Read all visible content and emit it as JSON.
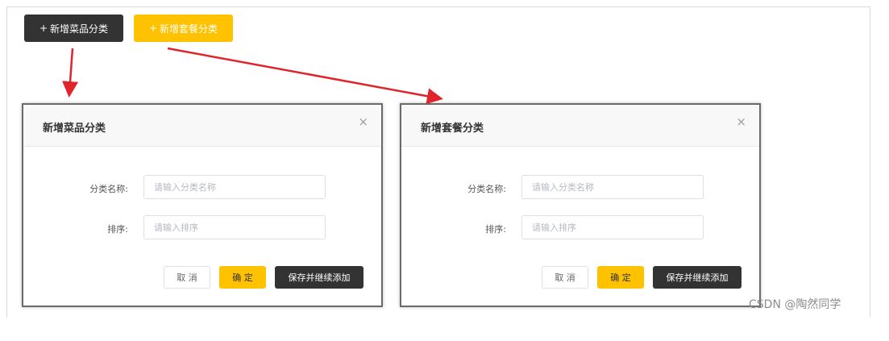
{
  "toolbar": {
    "add_dish_category": {
      "plus": "+",
      "label": "新增菜品分类"
    },
    "add_setmeal_category": {
      "plus": "+",
      "label": "新增套餐分类"
    }
  },
  "dialogs": [
    {
      "title": "新增菜品分类",
      "close": "×",
      "name_label": "分类名称:",
      "name_placeholder": "请输入分类名称",
      "sort_label": "排序:",
      "sort_placeholder": "请输入排序",
      "cancel": "取 消",
      "confirm": "确 定",
      "save_continue": "保存并继续添加"
    },
    {
      "title": "新增套餐分类",
      "close": "×",
      "name_label": "分类名称:",
      "name_placeholder": "请输入分类名称",
      "sort_label": "排序:",
      "sort_placeholder": "请输入排序",
      "cancel": "取 消",
      "confirm": "确 定",
      "save_continue": "保存并继续添加"
    }
  ],
  "watermark": "CSDN @陶然同学",
  "colors": {
    "dark": "#333333",
    "accent": "#ffc200",
    "arrow": "#e0242b"
  }
}
